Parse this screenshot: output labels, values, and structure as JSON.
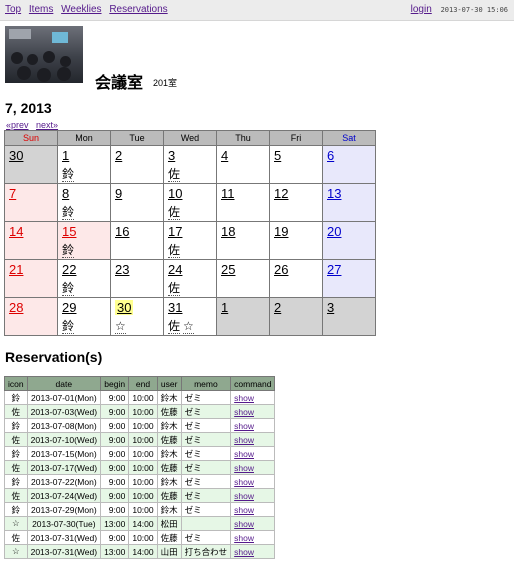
{
  "nav": {
    "top": "Top",
    "items": "Items",
    "weeklies": "Weeklies",
    "reservations": "Reservations",
    "login": "login",
    "timestamp": "2013-07-30 15:06"
  },
  "room": {
    "name": "会議室",
    "code": "201室"
  },
  "calendar": {
    "title": "7, 2013",
    "prev_label": "«prev",
    "next_label": "next»",
    "weekdays": [
      "Sun",
      "Mon",
      "Tue",
      "Wed",
      "Thu",
      "Fri",
      "Sat"
    ],
    "weeks": [
      [
        {
          "d": "30",
          "out": true,
          "m": []
        },
        {
          "d": "1",
          "m": [
            "鈴"
          ]
        },
        {
          "d": "2",
          "m": []
        },
        {
          "d": "3",
          "m": [
            "佐"
          ]
        },
        {
          "d": "4",
          "m": []
        },
        {
          "d": "5",
          "m": []
        },
        {
          "d": "6",
          "m": []
        }
      ],
      [
        {
          "d": "7",
          "m": []
        },
        {
          "d": "8",
          "m": [
            "鈴"
          ]
        },
        {
          "d": "9",
          "m": []
        },
        {
          "d": "10",
          "m": [
            "佐"
          ]
        },
        {
          "d": "11",
          "m": []
        },
        {
          "d": "12",
          "m": []
        },
        {
          "d": "13",
          "m": []
        }
      ],
      [
        {
          "d": "14",
          "m": []
        },
        {
          "d": "15",
          "holiday": true,
          "m": [
            "鈴"
          ]
        },
        {
          "d": "16",
          "m": []
        },
        {
          "d": "17",
          "m": [
            "佐"
          ]
        },
        {
          "d": "18",
          "m": []
        },
        {
          "d": "19",
          "m": []
        },
        {
          "d": "20",
          "m": []
        }
      ],
      [
        {
          "d": "21",
          "m": []
        },
        {
          "d": "22",
          "m": [
            "鈴"
          ]
        },
        {
          "d": "23",
          "m": []
        },
        {
          "d": "24",
          "m": [
            "佐"
          ]
        },
        {
          "d": "25",
          "m": []
        },
        {
          "d": "26",
          "m": []
        },
        {
          "d": "27",
          "m": []
        }
      ],
      [
        {
          "d": "28",
          "m": []
        },
        {
          "d": "29",
          "m": [
            "鈴"
          ]
        },
        {
          "d": "30",
          "today": true,
          "m": [
            "☆"
          ]
        },
        {
          "d": "31",
          "m": [
            "佐",
            "☆"
          ]
        },
        {
          "d": "1",
          "out": true,
          "m": []
        },
        {
          "d": "2",
          "out": true,
          "m": []
        },
        {
          "d": "3",
          "out": true,
          "m": []
        }
      ]
    ]
  },
  "reservations": {
    "title": "Reservation(s)",
    "headers": [
      "icon",
      "date",
      "begin",
      "end",
      "user",
      "memo",
      "command"
    ],
    "rows": [
      [
        "鈴",
        "2013-07-01(Mon)",
        "9:00",
        "10:00",
        "鈴木",
        "ゼミ",
        "show"
      ],
      [
        "佐",
        "2013-07-03(Wed)",
        "9:00",
        "10:00",
        "佐藤",
        "ゼミ",
        "show"
      ],
      [
        "鈴",
        "2013-07-08(Mon)",
        "9:00",
        "10:00",
        "鈴木",
        "ゼミ",
        "show"
      ],
      [
        "佐",
        "2013-07-10(Wed)",
        "9:00",
        "10:00",
        "佐藤",
        "ゼミ",
        "show"
      ],
      [
        "鈴",
        "2013-07-15(Mon)",
        "9:00",
        "10:00",
        "鈴木",
        "ゼミ",
        "show"
      ],
      [
        "佐",
        "2013-07-17(Wed)",
        "9:00",
        "10:00",
        "佐藤",
        "ゼミ",
        "show"
      ],
      [
        "鈴",
        "2013-07-22(Mon)",
        "9:00",
        "10:00",
        "鈴木",
        "ゼミ",
        "show"
      ],
      [
        "佐",
        "2013-07-24(Wed)",
        "9:00",
        "10:00",
        "佐藤",
        "ゼミ",
        "show"
      ],
      [
        "鈴",
        "2013-07-29(Mon)",
        "9:00",
        "10:00",
        "鈴木",
        "ゼミ",
        "show"
      ],
      [
        "☆",
        "2013-07-30(Tue)",
        "13:00",
        "14:00",
        "松田",
        "",
        "show"
      ],
      [
        "佐",
        "2013-07-31(Wed)",
        "9:00",
        "10:00",
        "佐藤",
        "ゼミ",
        "show"
      ],
      [
        "☆",
        "2013-07-31(Wed)",
        "13:00",
        "14:00",
        "山田",
        "打ち合わせ",
        "show"
      ]
    ]
  },
  "colors": {
    "sunday": "#dd0000",
    "saturday": "#0000cc",
    "today_highlight": "#ffff90",
    "table_header": "#8fa88f",
    "alt_row": "#e6f7e6"
  }
}
